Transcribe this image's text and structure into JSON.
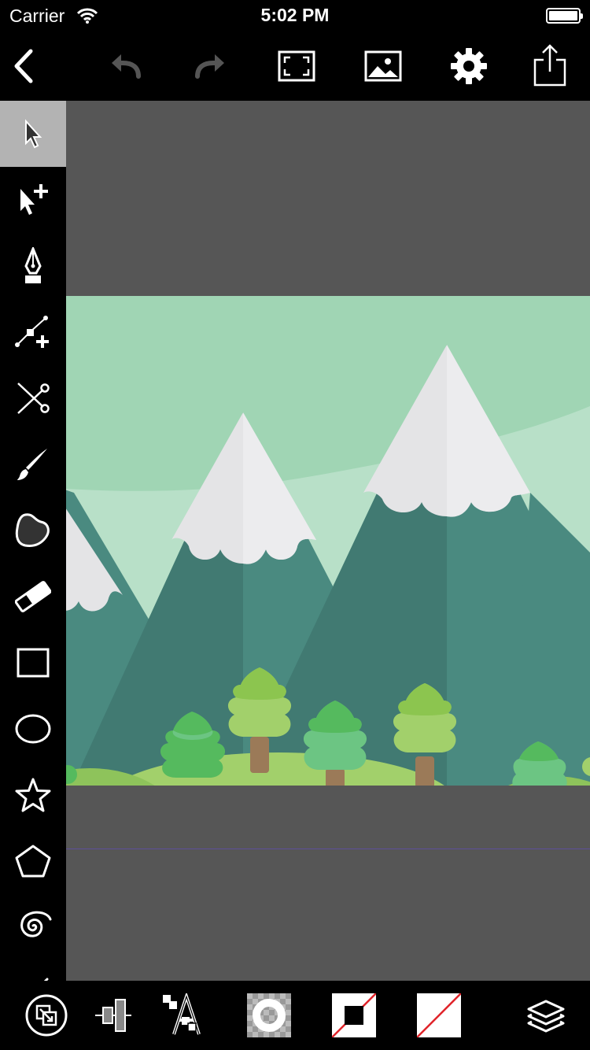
{
  "status_bar": {
    "carrier": "Carrier",
    "time": "5:02 PM"
  },
  "toolbar": {
    "items": [
      "back-icon",
      "undo-icon",
      "redo-icon",
      "fit-to-screen-icon",
      "image-icon",
      "gear-icon",
      "share-icon"
    ]
  },
  "tools": {
    "selected": "select-tool",
    "items": [
      "select-tool",
      "direct-select-tool",
      "pen-tool",
      "add-node-tool",
      "scissors-tool",
      "brush-tool",
      "blob-brush-tool",
      "eraser-tool",
      "rectangle-tool",
      "ellipse-tool",
      "star-tool",
      "polygon-tool",
      "spiral-tool",
      "line-tool"
    ]
  },
  "bottom_bar": {
    "items": [
      "arrange-icon",
      "align-icon",
      "text-icon",
      "opacity-icon",
      "fill-stroke-icon",
      "no-fill-icon",
      "layers-icon"
    ]
  },
  "colors": {
    "canvas_background": "#565656",
    "sky": "#a0d5b4",
    "sky_light": "#b8e0c8",
    "mountain": "#4a8a80",
    "mountain_shadow": "#417a72",
    "snow": "#e4e4e6",
    "tree_light": "#a2d06b",
    "tree_dark": "#55ba5e",
    "trunk": "#9b7a58",
    "guide": "#5d4f9a",
    "selected_tool_bg": "#b3b3b3"
  }
}
